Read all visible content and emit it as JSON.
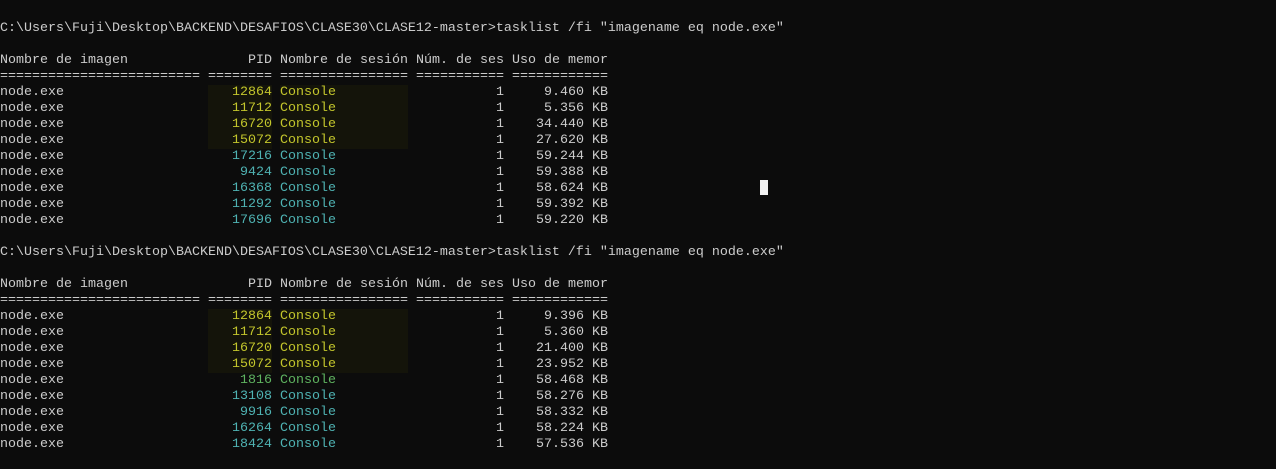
{
  "colors": {
    "background": "#0c0c0c",
    "text": "#cccccc",
    "yellow": "#c3c62c",
    "cyan": "#4fb3b3",
    "green": "#5fb35f"
  },
  "blocks": [
    {
      "prompt": "C:\\Users\\Fuji\\Desktop\\BACKEND\\DESAFIOS\\CLASE30\\CLASE12-master>tasklist /fi \"imagename eq node.exe\"",
      "headers": [
        "Nombre de imagen",
        "PID",
        "Nombre de sesión",
        "Núm. de ses",
        "Uso de memor"
      ],
      "separators": [
        "=========================",
        "========",
        "================",
        "===========",
        "============"
      ],
      "rows": [
        {
          "image": "node.exe",
          "pid": "12864",
          "session": "Console",
          "num": "1",
          "mem": "9.460 KB",
          "color": "yellow"
        },
        {
          "image": "node.exe",
          "pid": "11712",
          "session": "Console",
          "num": "1",
          "mem": "5.356 KB",
          "color": "yellow"
        },
        {
          "image": "node.exe",
          "pid": "16720",
          "session": "Console",
          "num": "1",
          "mem": "34.440 KB",
          "color": "yellow"
        },
        {
          "image": "node.exe",
          "pid": "15072",
          "session": "Console",
          "num": "1",
          "mem": "27.620 KB",
          "color": "yellow"
        },
        {
          "image": "node.exe",
          "pid": "17216",
          "session": "Console",
          "num": "1",
          "mem": "59.244 KB",
          "color": "cyan"
        },
        {
          "image": "node.exe",
          "pid": "9424",
          "session": "Console",
          "num": "1",
          "mem": "59.388 KB",
          "color": "cyan"
        },
        {
          "image": "node.exe",
          "pid": "16368",
          "session": "Console",
          "num": "1",
          "mem": "58.624 KB",
          "color": "cyan"
        },
        {
          "image": "node.exe",
          "pid": "11292",
          "session": "Console",
          "num": "1",
          "mem": "59.392 KB",
          "color": "cyan"
        },
        {
          "image": "node.exe",
          "pid": "17696",
          "session": "Console",
          "num": "1",
          "mem": "59.220 KB",
          "color": "cyan"
        }
      ]
    },
    {
      "prompt": "C:\\Users\\Fuji\\Desktop\\BACKEND\\DESAFIOS\\CLASE30\\CLASE12-master>tasklist /fi \"imagename eq node.exe\"",
      "headers": [
        "Nombre de imagen",
        "PID",
        "Nombre de sesión",
        "Núm. de ses",
        "Uso de memor"
      ],
      "separators": [
        "=========================",
        "========",
        "================",
        "===========",
        "============"
      ],
      "rows": [
        {
          "image": "node.exe",
          "pid": "12864",
          "session": "Console",
          "num": "1",
          "mem": "9.396 KB",
          "color": "yellow"
        },
        {
          "image": "node.exe",
          "pid": "11712",
          "session": "Console",
          "num": "1",
          "mem": "5.360 KB",
          "color": "yellow"
        },
        {
          "image": "node.exe",
          "pid": "16720",
          "session": "Console",
          "num": "1",
          "mem": "21.400 KB",
          "color": "yellow"
        },
        {
          "image": "node.exe",
          "pid": "15072",
          "session": "Console",
          "num": "1",
          "mem": "23.952 KB",
          "color": "yellow"
        },
        {
          "image": "node.exe",
          "pid": "1816",
          "session": "Console",
          "num": "1",
          "mem": "58.468 KB",
          "color": "green"
        },
        {
          "image": "node.exe",
          "pid": "13108",
          "session": "Console",
          "num": "1",
          "mem": "58.276 KB",
          "color": "cyan"
        },
        {
          "image": "node.exe",
          "pid": "9916",
          "session": "Console",
          "num": "1",
          "mem": "58.332 KB",
          "color": "cyan"
        },
        {
          "image": "node.exe",
          "pid": "16264",
          "session": "Console",
          "num": "1",
          "mem": "58.224 KB",
          "color": "cyan"
        },
        {
          "image": "node.exe",
          "pid": "18424",
          "session": "Console",
          "num": "1",
          "mem": "57.536 KB",
          "color": "cyan"
        }
      ]
    }
  ]
}
